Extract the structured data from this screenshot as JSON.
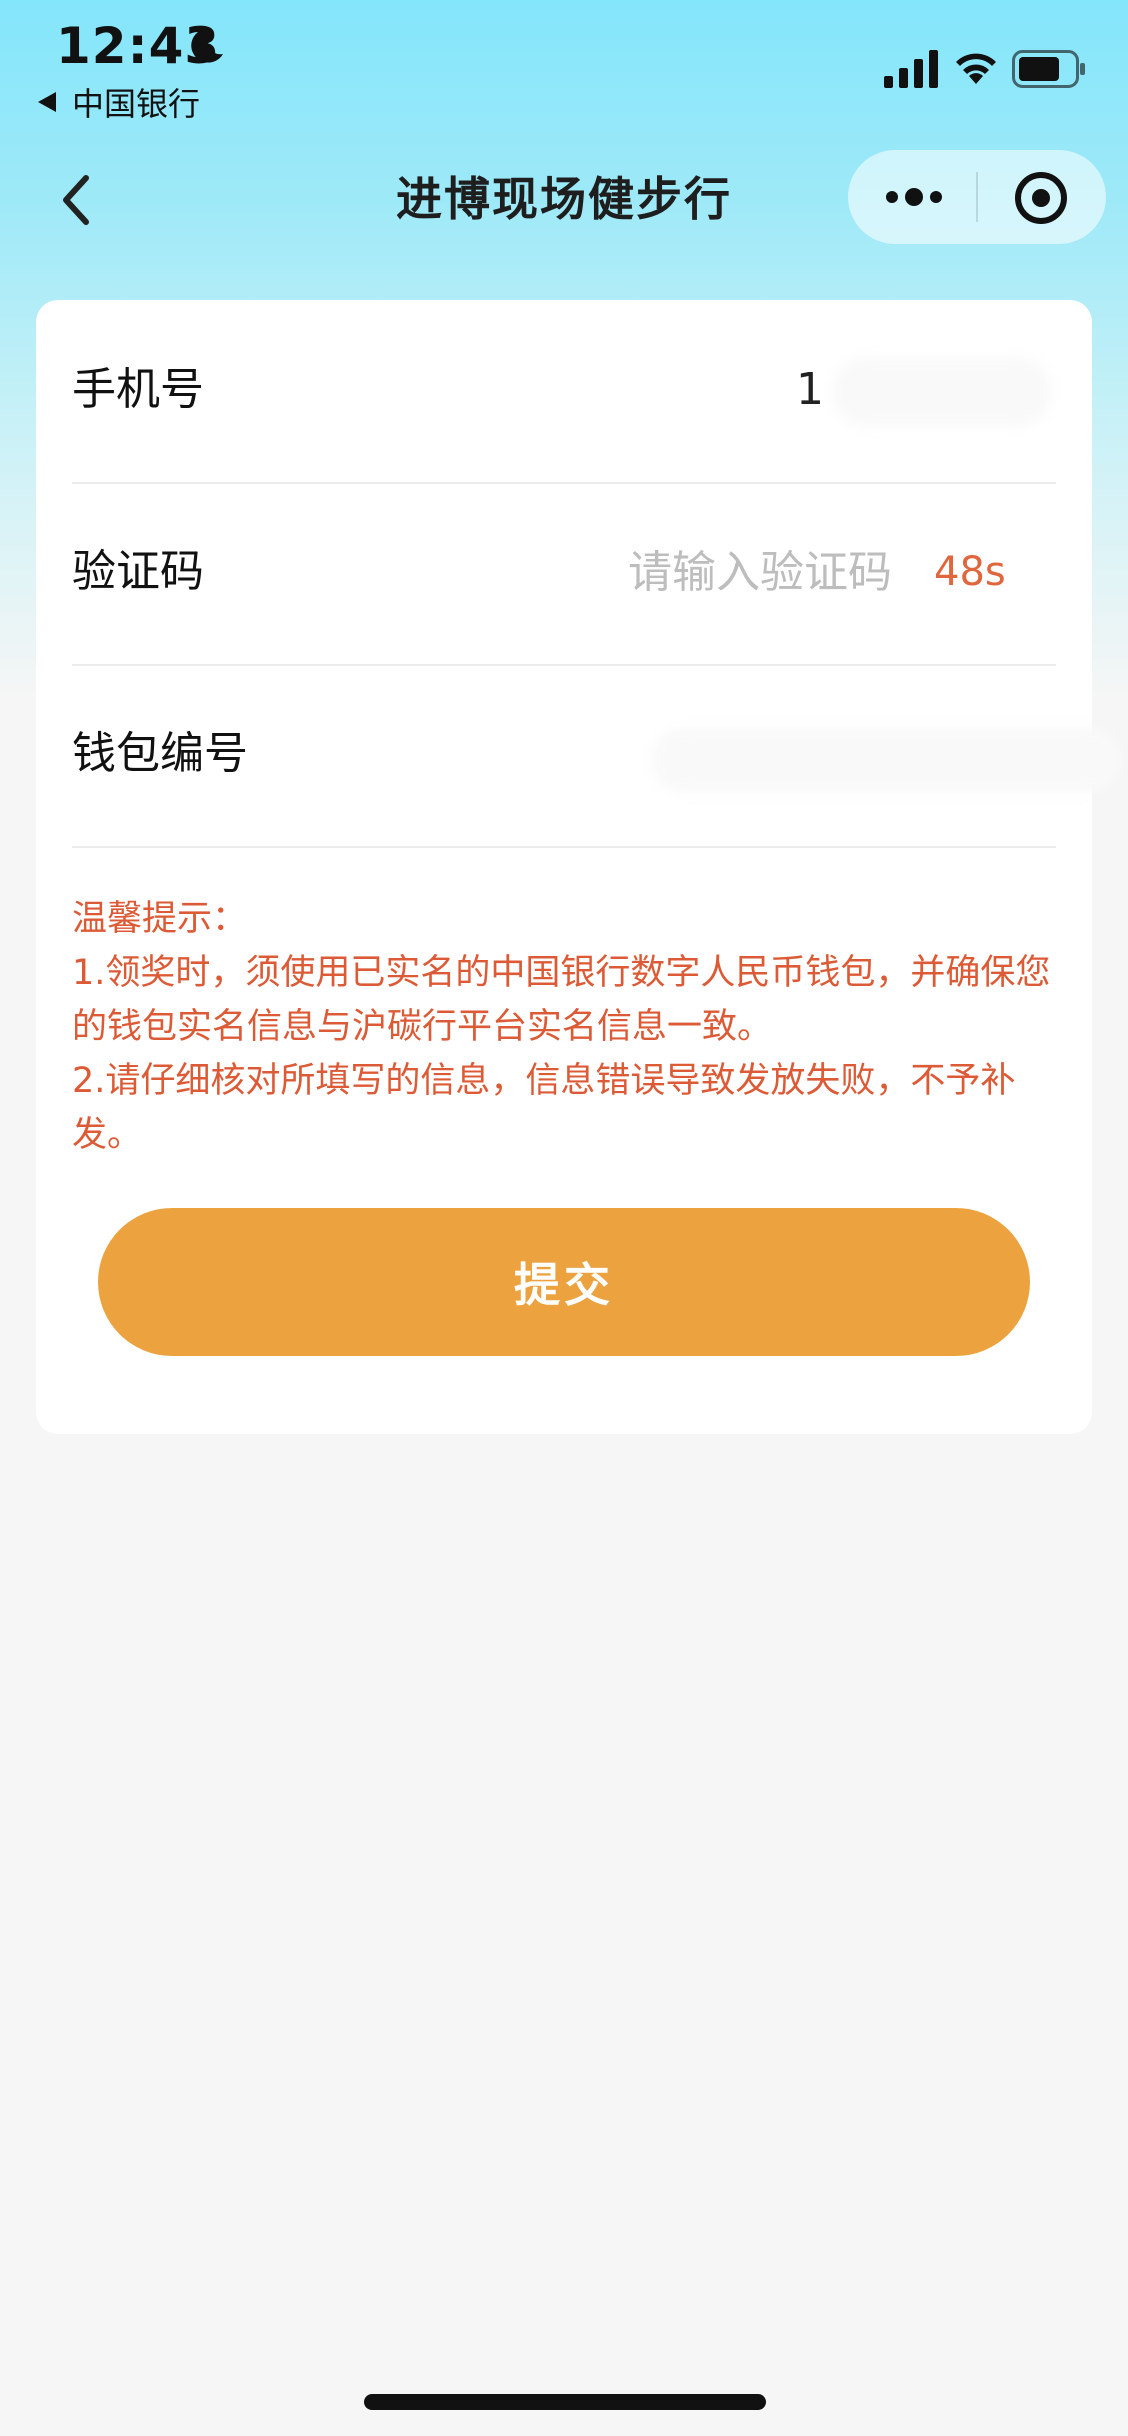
{
  "status_bar": {
    "time": "12:43",
    "back_app_label": "中国银行"
  },
  "nav": {
    "title": "进博现场健步行"
  },
  "form": {
    "phone": {
      "label": "手机号",
      "value": "1"
    },
    "code": {
      "label": "验证码",
      "placeholder": "请输入验证码",
      "countdown": "48s"
    },
    "wallet": {
      "label": "钱包编号"
    }
  },
  "tips": {
    "heading": "温馨提示：",
    "lines": [
      "1.领奖时，须使用已实名的中国银行数字人民币钱包，并确保您的钱包实名信息与沪碳行平台实名信息一致。",
      "2.请仔细核对所填写的信息，信息错误导致发放失败，不予补发。"
    ]
  },
  "submit_label": "提交",
  "colors": {
    "accent": "#eba23f",
    "warning_text": "#dc5b36",
    "header_gradient_top": "#84e6fb",
    "background": "#f6f6f6"
  },
  "icons": {
    "moon": "moon-icon",
    "signal": "signal-icon",
    "wifi": "wifi-icon",
    "battery": "battery-icon",
    "back": "chevron-left-icon",
    "more": "more-icon",
    "close": "close-miniprogram-icon"
  }
}
